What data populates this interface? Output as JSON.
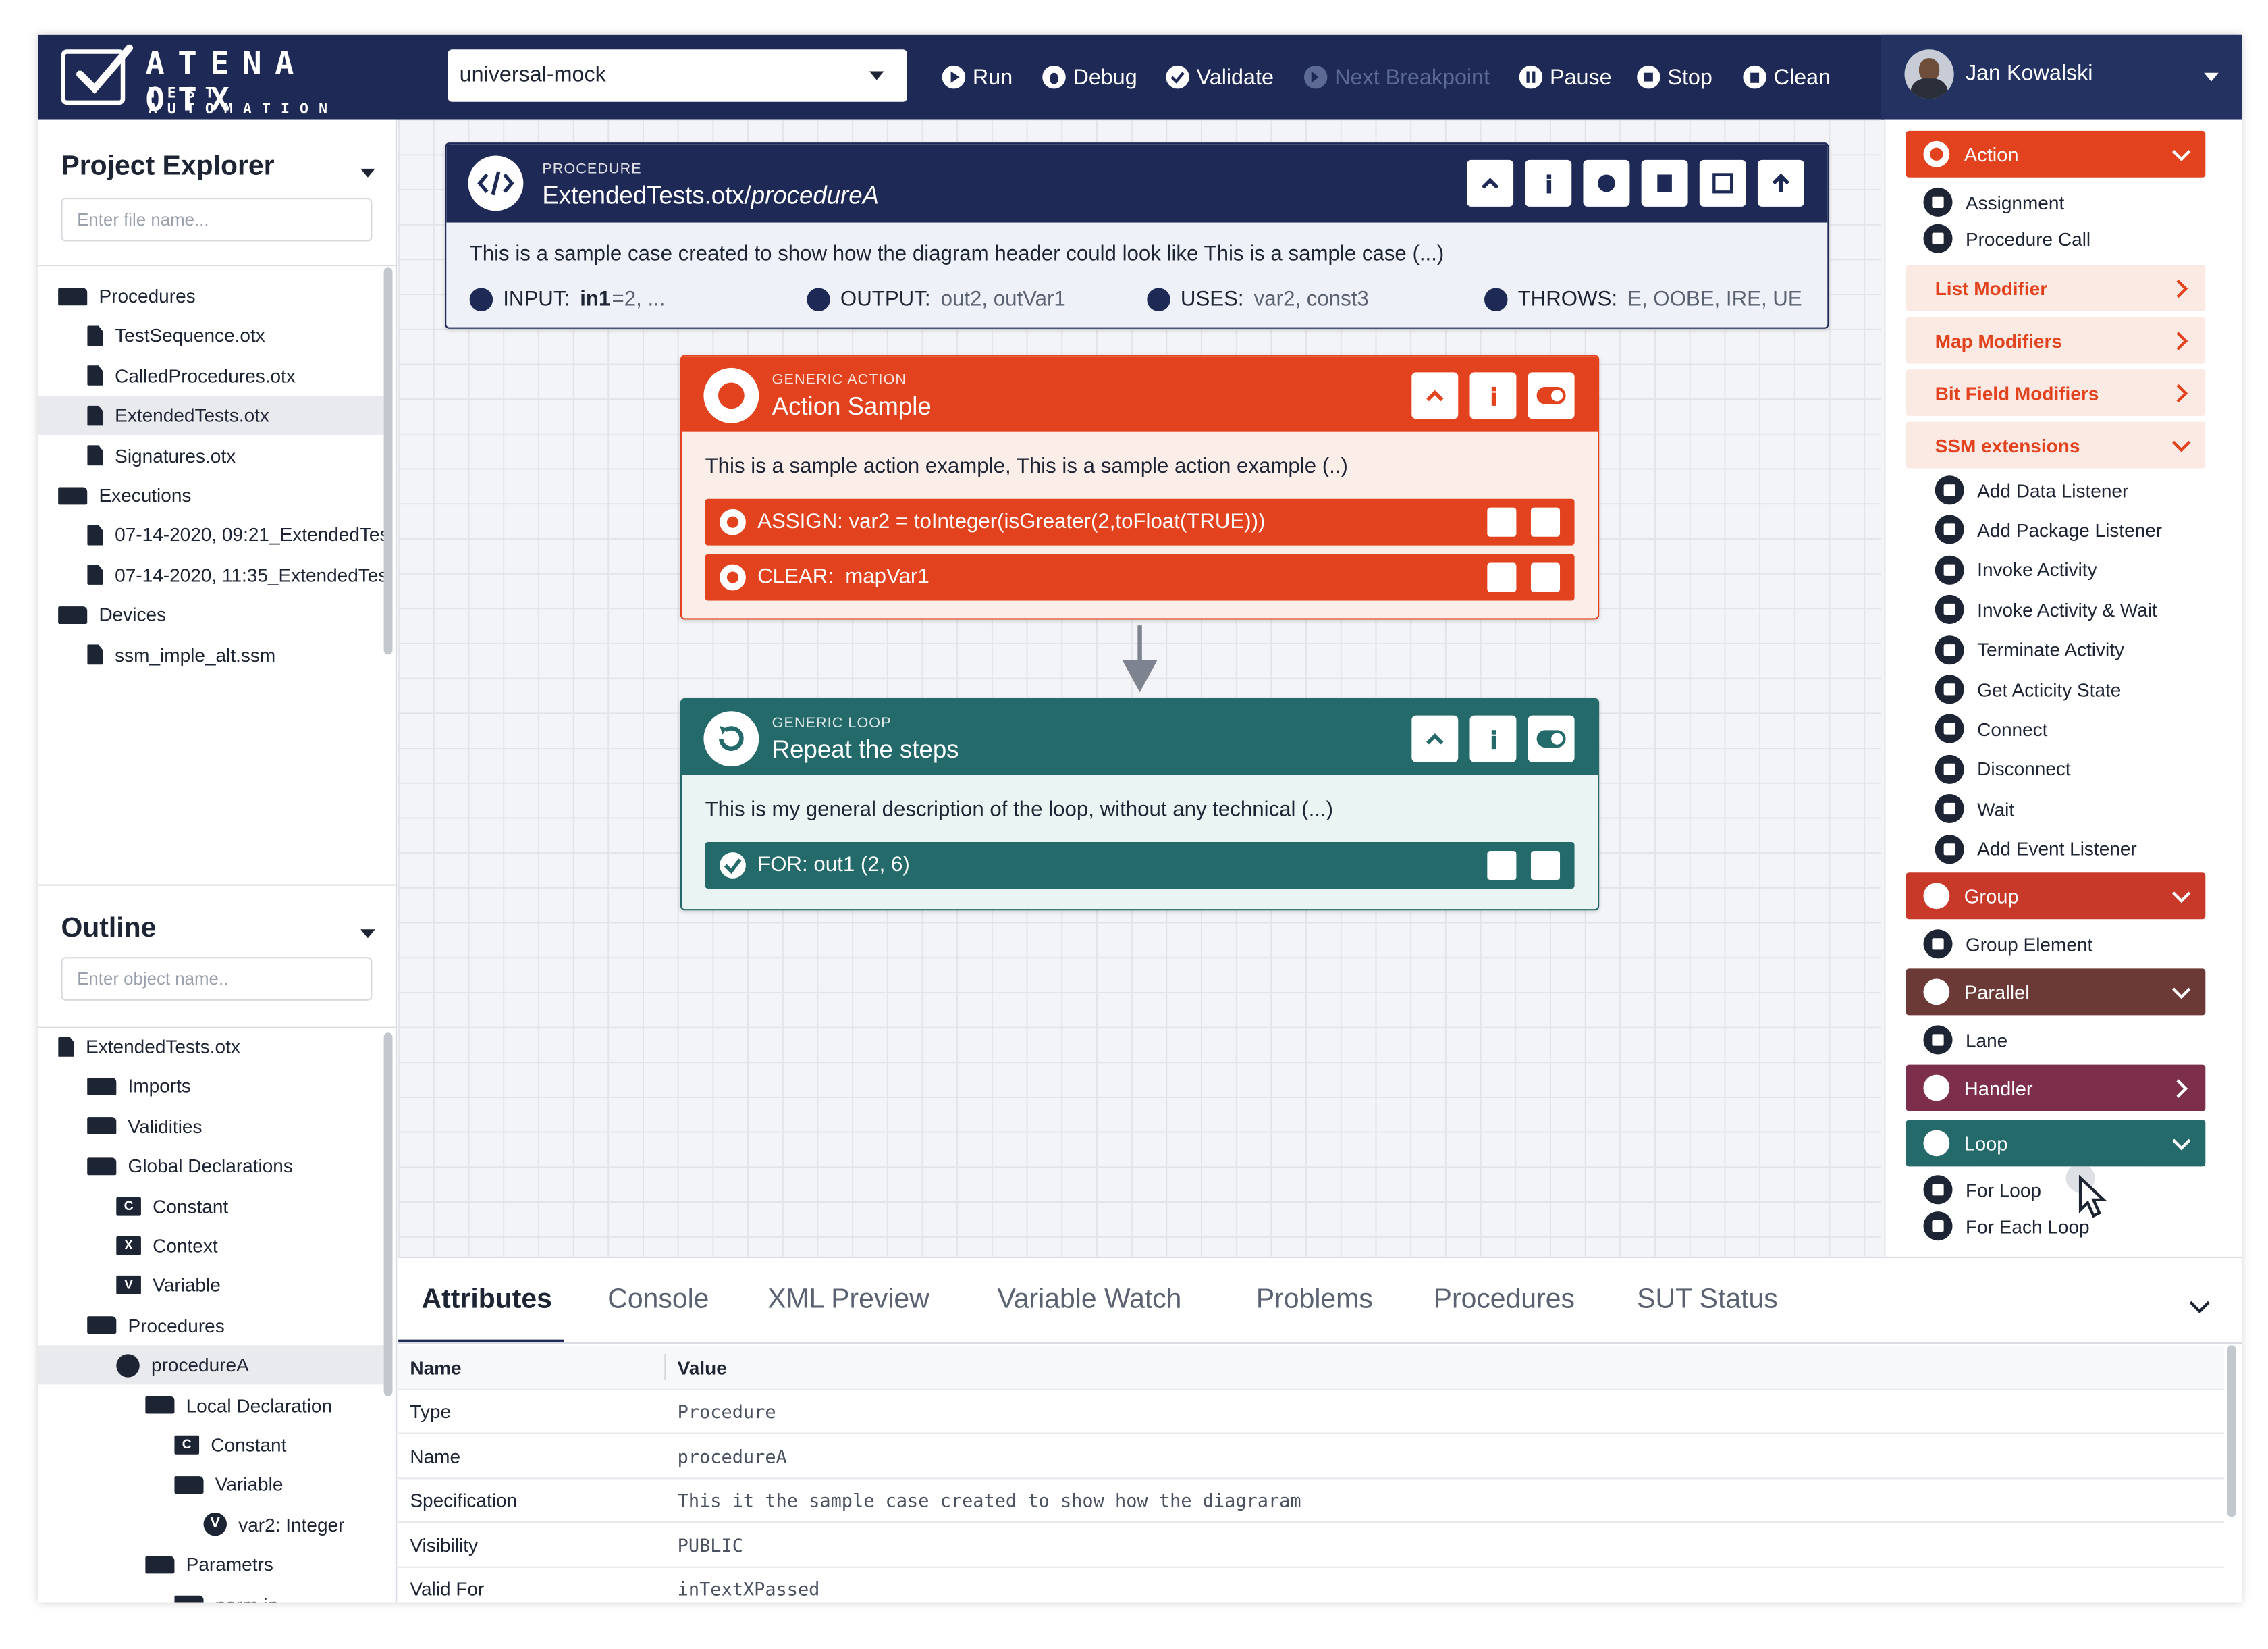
{
  "header": {
    "logo_title": "ATENA OTX",
    "logo_subtitle": "TEST AUTOMATION",
    "environment": "universal-mock",
    "toolbar": [
      {
        "label": "Run",
        "enabled": true
      },
      {
        "label": "Debug",
        "enabled": true
      },
      {
        "label": "Validate",
        "enabled": true
      },
      {
        "label": "Next Breakpoint",
        "enabled": false
      },
      {
        "label": "Pause",
        "enabled": true
      },
      {
        "label": "Stop",
        "enabled": true
      },
      {
        "label": "Clean",
        "enabled": true
      }
    ],
    "user_name": "Jan Kowalski"
  },
  "project_explorer": {
    "title": "Project Explorer",
    "search_placeholder": "Enter file name...",
    "items": [
      {
        "label": "Procedures",
        "icon": "folder-open-icon",
        "level": 0
      },
      {
        "label": "TestSequence.otx",
        "icon": "file-icon",
        "level": 1
      },
      {
        "label": "CalledProcedures.otx",
        "icon": "file-icon",
        "level": 1
      },
      {
        "label": "ExtendedTests.otx",
        "icon": "file-icon",
        "level": 1,
        "selected": true
      },
      {
        "label": "Signatures.otx",
        "icon": "file-icon",
        "level": 1
      },
      {
        "label": "Executions",
        "icon": "folder-open-icon",
        "level": 0
      },
      {
        "label": "07-14-2020, 09:21_ExtendedTes",
        "icon": "file-icon",
        "level": 1
      },
      {
        "label": "07-14-2020, 11:35_ExtendedTes",
        "icon": "file-icon",
        "level": 1
      },
      {
        "label": "Devices",
        "icon": "folder-open-icon",
        "level": 0
      },
      {
        "label": "ssm_imple_alt.ssm",
        "icon": "ssm-file-icon",
        "level": 1
      }
    ]
  },
  "outline": {
    "title": "Outline",
    "search_placeholder": "Enter object name..",
    "items": [
      {
        "label": "ExtendedTests.otx",
        "icon": "file-icon",
        "level": 0
      },
      {
        "label": "Imports",
        "icon": "folder-import-icon",
        "level": 1
      },
      {
        "label": "Validities",
        "icon": "folder-check-icon",
        "level": 1
      },
      {
        "label": "Global Declarations",
        "icon": "folder-open-icon",
        "level": 1
      },
      {
        "label": "Constant",
        "icon": "constant-icon",
        "letter": "C",
        "level": 2
      },
      {
        "label": "Context",
        "icon": "context-icon",
        "letter": "X",
        "level": 2
      },
      {
        "label": "Variable",
        "icon": "variable-icon",
        "letter": "V",
        "level": 2
      },
      {
        "label": "Procedures",
        "icon": "folder-open-icon",
        "level": 1
      },
      {
        "label": "procedureA",
        "icon": "code-icon",
        "level": 2,
        "selected": true
      },
      {
        "label": "Local Declaration",
        "icon": "folder-open-icon",
        "level": 3
      },
      {
        "label": "Constant",
        "icon": "constant-icon",
        "letter": "C",
        "level": 4
      },
      {
        "label": "Variable",
        "icon": "folder-open-icon",
        "level": 4
      },
      {
        "label": "var2: Integer",
        "icon": "variable-circle-icon",
        "letter": "V",
        "level": 5
      },
      {
        "label": "Parametrs",
        "icon": "folder-open-icon",
        "level": 3
      },
      {
        "label": "parm in",
        "icon": "folder-open-icon",
        "level": 4
      }
    ]
  },
  "procedure": {
    "kind": "PROCEDURE",
    "path_prefix": "ExtendedTests.otx/",
    "name": "procedureA",
    "description": "This is a sample case created to show how the diagram header could look like This is a sample case (...)",
    "input_label": "INPUT:",
    "input_name": "in1",
    "input_rest": "=2, ...",
    "output_label": "OUTPUT:",
    "output_value": "out2, outVar1",
    "uses_label": "USES:",
    "uses_value": "var2, const3",
    "throws_label": "THROWS:",
    "throws_value": "E, OOBE, IRE, UE"
  },
  "action": {
    "kind": "GENERIC ACTION",
    "title": "Action Sample",
    "description": "This is a sample action example, This is a sample action example (..)",
    "rows": [
      {
        "label": "ASSIGN: var2 = toInteger(isGreater(2,toFloat(TRUE)))"
      },
      {
        "label": "CLEAR:  mapVar1"
      }
    ]
  },
  "loop": {
    "kind": "GENERIC LOOP",
    "title": "Repeat the steps",
    "description": "This is my general description of the loop, without any technical (...)",
    "row": "FOR: out1 (2, 6)"
  },
  "palette": {
    "action_header": "Action",
    "action_items": [
      "Assignment",
      "Procedure Call"
    ],
    "sub_groups": [
      "List Modifier",
      "Map Modifiers",
      "Bit Field Modifiers"
    ],
    "ssm_header": "SSM extensions",
    "ssm_items": [
      "Add Data Listener",
      "Add Package Listener",
      "Invoke Activity",
      "Invoke Activity & Wait",
      "Terminate Activity",
      "Get Acticity State",
      "Connect",
      "Disconnect",
      "Wait",
      "Add Event Listener"
    ],
    "group_header": "Group",
    "group_items": [
      "Group Element"
    ],
    "parallel_header": "Parallel",
    "parallel_items": [
      "Lane"
    ],
    "handler_header": "Handler",
    "loop_header": "Loop",
    "loop_items": [
      "For Loop",
      "For Each Loop"
    ]
  },
  "bottom": {
    "tabs": [
      "Attributes",
      "Console",
      "XML Preview",
      "Variable Watch",
      "Problems",
      "Procedures",
      "SUT Status"
    ],
    "active_tab": "Attributes",
    "columns": [
      "Name",
      "Value"
    ],
    "rows": [
      {
        "name": "Type",
        "value": "Procedure"
      },
      {
        "name": "Name",
        "value": "procedureA"
      },
      {
        "name": "Specification",
        "value": "This it the sample case created to show how the diagraram"
      },
      {
        "name": "Visibility",
        "value": "PUBLIC"
      },
      {
        "name": "Valid For",
        "value": "inTextXPassed"
      }
    ]
  },
  "colors": {
    "navy": "#1e2a55",
    "action": "#e2431e",
    "loop": "#246a6a",
    "group": "#c9392a",
    "parallel": "#6b3a36",
    "handler": "#7c2e4a"
  }
}
